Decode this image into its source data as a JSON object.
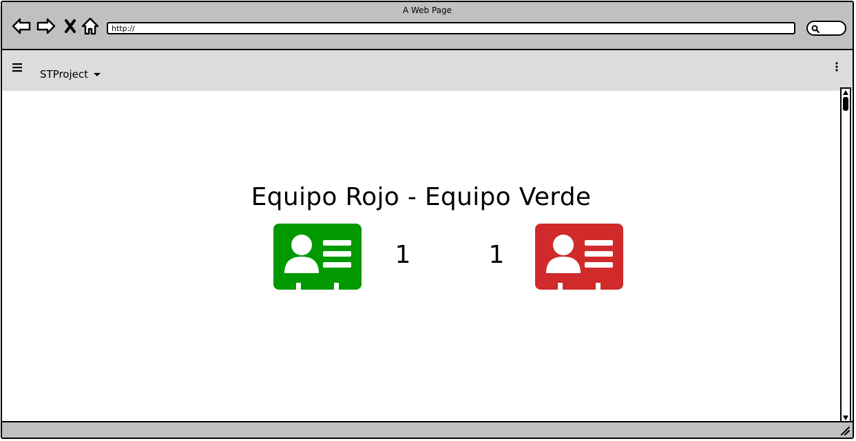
{
  "window": {
    "title": "A Web Page"
  },
  "toolbar": {
    "back_icon": "arrow-left-icon",
    "forward_icon": "arrow-right-icon",
    "stop_icon": "close-x-icon",
    "home_icon": "home-icon",
    "url": "http://",
    "search_icon": "search-icon"
  },
  "appbar": {
    "menu_icon": "hamburger-menu-icon",
    "project_name": "STProject",
    "dropdown_icon": "caret-down-icon",
    "more_icon": "more-vertical-icon"
  },
  "main": {
    "headline": "Equipo Rojo - Equipo Verde",
    "teams": [
      {
        "card_color": "#009900",
        "icon": "id-card-icon",
        "score": "1"
      },
      {
        "card_color": "#d02a2a",
        "icon": "id-card-icon",
        "score": "1"
      }
    ]
  },
  "colors": {
    "titlebar": "#c0c0c0",
    "appbar": "#dcdcdc",
    "statusbar": "#c0c0c0"
  }
}
